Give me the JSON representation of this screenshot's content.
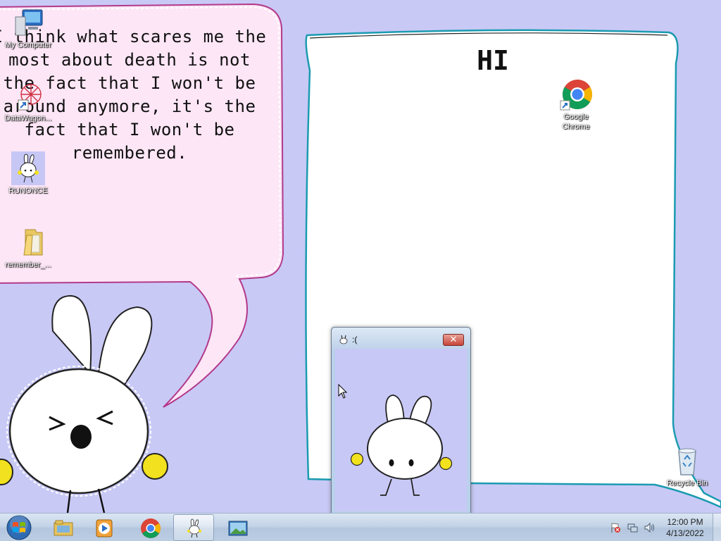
{
  "wallpaper": {
    "quote": "I think what scares me the most about death is not the fact that I won't be around anymore, it's the fact that I won't be remembered.",
    "note_text": "HI"
  },
  "desktop_icons": [
    {
      "label": "My Computer",
      "icon": "computer-icon"
    },
    {
      "label": "DataWagon...",
      "icon": "datawagon-icon"
    },
    {
      "label": "RUNONCE",
      "icon": "bunny-app-icon"
    },
    {
      "label": "remember_...",
      "icon": "folder-icon"
    },
    {
      "label": "Google Chrome",
      "icon": "chrome-icon"
    },
    {
      "label": "Recycle Bin",
      "icon": "recycle-bin-icon"
    }
  ],
  "window": {
    "title": ":(",
    "close_label": "✕",
    "icon": "bunny-icon"
  },
  "taskbar": {
    "start_icon": "windows-logo-icon",
    "buttons": [
      {
        "name": "explorer",
        "icon": "folder-icon",
        "active": false
      },
      {
        "name": "media-player",
        "icon": "media-player-icon",
        "active": false
      },
      {
        "name": "chrome",
        "icon": "chrome-icon",
        "active": false
      },
      {
        "name": "bunny-window",
        "icon": "bunny-icon",
        "active": true
      },
      {
        "name": "image-viewer",
        "icon": "image-icon",
        "active": false
      }
    ],
    "tray_icons": [
      "action-center-flag-icon",
      "network-icon",
      "volume-icon"
    ],
    "clock_time": "12:00 PM",
    "clock_date": "4/13/2022"
  },
  "colors": {
    "wallpaper_bg": "#c9c9f6",
    "speech_bubble": "#fde6f5",
    "note_paper": "#ffffff",
    "bunny_cheeks": "#f0e020"
  }
}
